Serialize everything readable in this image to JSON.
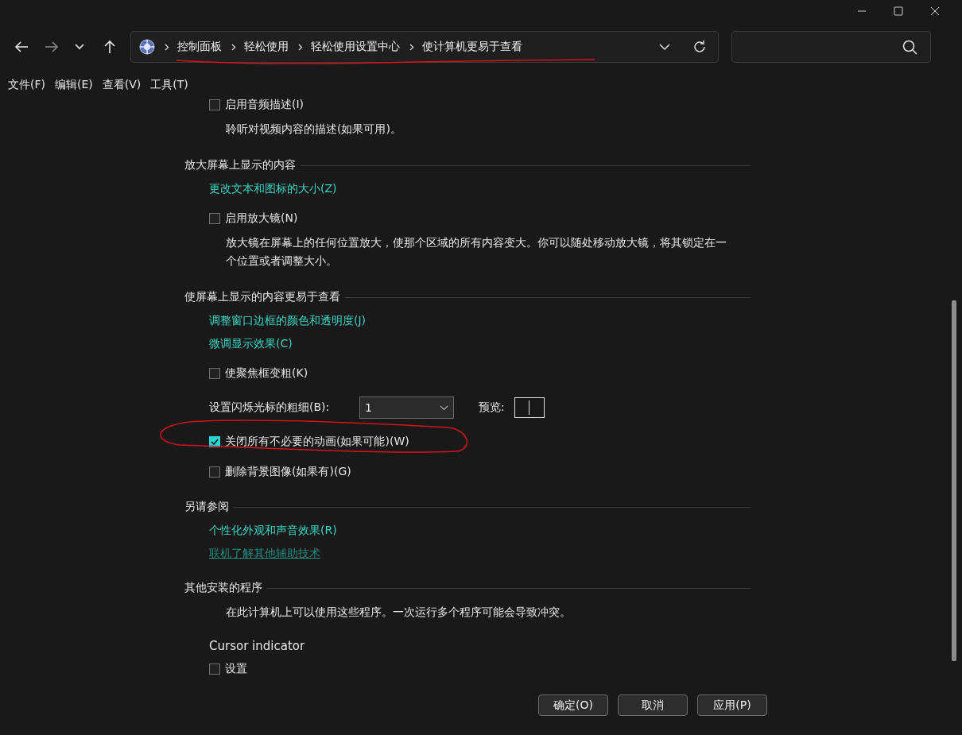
{
  "address_bar": {
    "crumbs": [
      "控制面板",
      "轻松使用",
      "轻松使用设置中心",
      "使计算机更易于查看"
    ]
  },
  "menu": [
    "文件(F)",
    "编辑(E)",
    "查看(V)",
    "工具(T)"
  ],
  "sections": [
    {
      "items": [
        {
          "kind": "checkbox",
          "label": "启用音频描述(I)",
          "checked": false
        },
        {
          "kind": "description",
          "text": "聆听对视频内容的描述(如果可用)。"
        }
      ]
    },
    {
      "title": "放大屏幕上显示的内容",
      "items": [
        {
          "kind": "link",
          "label": "更改文本和图标的大小(Z)",
          "visited": false
        },
        {
          "kind": "checkbox",
          "label": "启用放大镜(N)",
          "checked": false
        },
        {
          "kind": "description",
          "text": "放大镜在屏幕上的任何位置放大，使那个区域的所有内容变大。你可以随处移动放大镜，将其锁定在一个位置或者调整大小。"
        }
      ]
    },
    {
      "title": "使屏幕上显示的内容更易于查看",
      "items": [
        {
          "kind": "link",
          "label": "调整窗口边框的颜色和透明度(J)",
          "visited": false
        },
        {
          "kind": "link",
          "label": "微调显示效果(C)",
          "visited": false
        },
        {
          "kind": "checkbox",
          "label": "使聚焦框变粗(K)",
          "checked": false
        },
        {
          "kind": "dropdown",
          "label": "设置闪烁光标的粗细(B):",
          "value": "1",
          "preview_label": "预览:"
        },
        {
          "kind": "checkbox",
          "label": "关闭所有不必要的动画(如果可能)(W)",
          "checked": true
        },
        {
          "kind": "checkbox",
          "label": "删除背景图像(如果有)(G)",
          "checked": false
        }
      ]
    },
    {
      "title": "另请参阅",
      "items": [
        {
          "kind": "link",
          "label": "个性化外观和声音效果(R)",
          "visited": false
        },
        {
          "kind": "link",
          "label": "联机了解其他辅助技术",
          "visited": true
        }
      ]
    },
    {
      "title": "其他安装的程序",
      "items": [
        {
          "kind": "description",
          "text": "在此计算机上可以使用这些程序。一次运行多个程序可能会导致冲突。"
        },
        {
          "kind": "subheading",
          "text": "Cursor indicator"
        },
        {
          "kind": "checkbox",
          "label": "设置",
          "checked": false
        }
      ]
    }
  ],
  "buttons": [
    "确定(O)",
    "取消",
    "应用(P)"
  ]
}
